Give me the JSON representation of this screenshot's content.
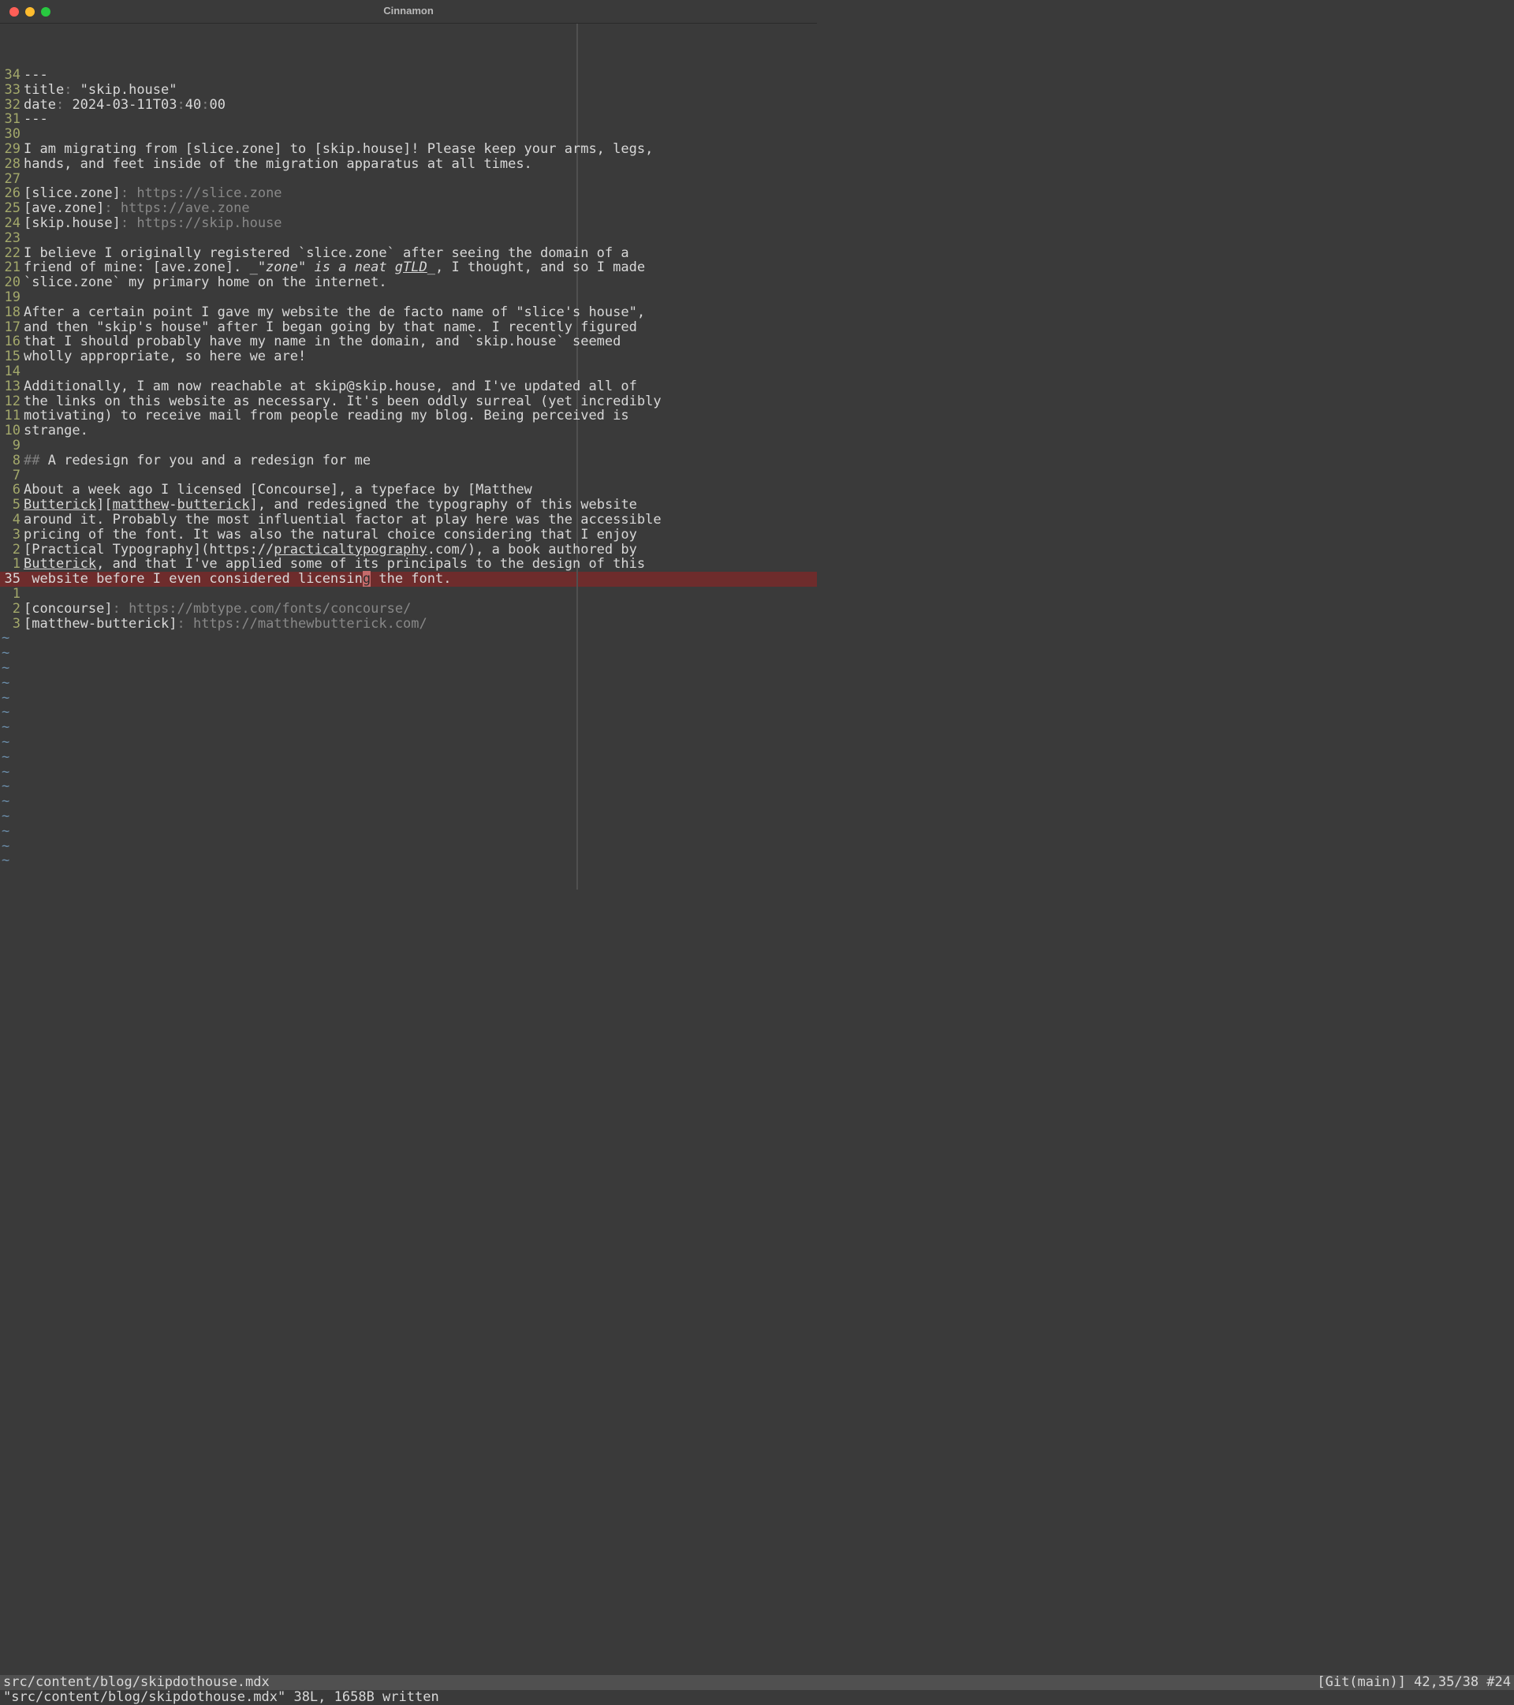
{
  "window": {
    "title": "Cinnamon"
  },
  "gutter": [
    "34",
    "33",
    "32",
    "31",
    "30",
    "29",
    "28",
    "27",
    "26",
    "25",
    "24",
    "23",
    "22",
    "21",
    "20",
    "19",
    "18",
    "17",
    "16",
    "15",
    "14",
    "13",
    "12",
    "11",
    "10",
    "9",
    "8",
    "7",
    "6",
    "5",
    "4",
    "3",
    "2",
    "1",
    "35",
    "1",
    "2",
    "3"
  ],
  "cursor_line_index": 34,
  "tilde_count": 16,
  "lines": [
    [
      {
        "t": "---",
        "c": "normal"
      }
    ],
    [
      {
        "t": "title",
        "c": "normal"
      },
      {
        "t": ": ",
        "c": "kw"
      },
      {
        "t": "\"skip.house\"",
        "c": "normal"
      }
    ],
    [
      {
        "t": "date",
        "c": "normal"
      },
      {
        "t": ": ",
        "c": "kw"
      },
      {
        "t": "2024-03-11T03",
        "c": "normal"
      },
      {
        "t": ":",
        "c": "kw"
      },
      {
        "t": "40",
        "c": "normal"
      },
      {
        "t": ":",
        "c": "kw"
      },
      {
        "t": "00",
        "c": "normal"
      }
    ],
    [
      {
        "t": "---",
        "c": "normal"
      }
    ],
    [],
    [
      {
        "t": "I am migrating from [slice.zone] to [skip.house]! Please keep your arms, legs,",
        "c": "normal"
      }
    ],
    [
      {
        "t": "hands, and feet inside of the migration apparatus at all times.",
        "c": "normal"
      }
    ],
    [],
    [
      {
        "t": "[slice.zone]",
        "c": "normal"
      },
      {
        "t": ": ",
        "c": "kw"
      },
      {
        "t": "https://slice.zone",
        "c": "url"
      }
    ],
    [
      {
        "t": "[ave.zone]",
        "c": "normal"
      },
      {
        "t": ": ",
        "c": "kw"
      },
      {
        "t": "https://ave.zone",
        "c": "url"
      }
    ],
    [
      {
        "t": "[skip.house]",
        "c": "normal"
      },
      {
        "t": ": ",
        "c": "kw"
      },
      {
        "t": "https://skip.house",
        "c": "url"
      }
    ],
    [],
    [
      {
        "t": "I believe I originally registered `slice.zone` after seeing the domain of a",
        "c": "normal"
      }
    ],
    [
      {
        "t": "friend of mine: [ave.zone]. ",
        "c": "normal"
      },
      {
        "t": "_\"zone\" is a neat g",
        "c": "normal italic"
      },
      {
        "t": "TLD",
        "c": "normal italic underline"
      },
      {
        "t": "_",
        "c": "normal italic"
      },
      {
        "t": ", I thought, and so I made",
        "c": "normal"
      }
    ],
    [
      {
        "t": "`slice.zone` my primary home on the internet.",
        "c": "normal"
      }
    ],
    [],
    [
      {
        "t": "After a certain point I gave my website the de facto name of \"slice's house\",",
        "c": "normal"
      }
    ],
    [
      {
        "t": "and then \"skip's house\" after I began going by that name. I recently figured",
        "c": "normal"
      }
    ],
    [
      {
        "t": "that I should probably have my name in the domain, and `skip.house` seemed",
        "c": "normal"
      }
    ],
    [
      {
        "t": "wholly appropriate, so here we are!",
        "c": "normal"
      }
    ],
    [],
    [
      {
        "t": "Additionally, I am now reachable at skip@skip.house, and I've updated all of",
        "c": "normal"
      }
    ],
    [
      {
        "t": "the links on this website as necessary. It's been oddly surreal (yet incredibly",
        "c": "normal"
      }
    ],
    [
      {
        "t": "motivating) to receive mail from people reading my blog. Being perceived is",
        "c": "normal"
      }
    ],
    [
      {
        "t": "strange.",
        "c": "normal"
      }
    ],
    [],
    [
      {
        "t": "##",
        "c": "kw"
      },
      {
        "t": " A redesign for you and a redesign for me",
        "c": "normal"
      }
    ],
    [],
    [
      {
        "t": "About a week ago I licensed [Concourse], a typeface by [Matthew",
        "c": "normal"
      }
    ],
    [
      {
        "t": "Butterick",
        "c": "normal underline"
      },
      {
        "t": "][",
        "c": "normal"
      },
      {
        "t": "matthew",
        "c": "normal underline"
      },
      {
        "t": "-",
        "c": "normal"
      },
      {
        "t": "butterick",
        "c": "normal underline"
      },
      {
        "t": "], and redesigned the typography of this website",
        "c": "normal"
      }
    ],
    [
      {
        "t": "around it. Probably the most influential factor at play here was the accessible",
        "c": "normal"
      }
    ],
    [
      {
        "t": "pricing of the font. It was also the natural choice considering that I enjoy",
        "c": "normal"
      }
    ],
    [
      {
        "t": "[Practical Typography](https://",
        "c": "normal"
      },
      {
        "t": "practicaltypography",
        "c": "normal underline"
      },
      {
        "t": ".com/), a book authored by",
        "c": "normal"
      }
    ],
    [
      {
        "t": "Butterick",
        "c": "normal underline"
      },
      {
        "t": ", and that I've applied some of its principals to the design of this",
        "c": "normal"
      }
    ],
    [
      {
        "t": " website before I even considered licensin",
        "c": "normal"
      },
      {
        "t": "g",
        "c": "cursor-cell"
      },
      {
        "t": " the font.",
        "c": "normal"
      }
    ],
    [],
    [
      {
        "t": "[concourse]",
        "c": "normal"
      },
      {
        "t": ": ",
        "c": "kw"
      },
      {
        "t": "https://mbtype.com/fonts/concourse/",
        "c": "url"
      }
    ],
    [
      {
        "t": "[matthew-butterick]",
        "c": "normal"
      },
      {
        "t": ": ",
        "c": "kw"
      },
      {
        "t": "https://matthewbutterick.com/",
        "c": "url"
      }
    ]
  ],
  "status": {
    "file": "src/content/blog/skipdothouse.mdx",
    "right": "[Git(main)] 42,35/38 #24",
    "message": "\"src/content/blog/skipdothouse.mdx\" 38L, 1658B written"
  }
}
